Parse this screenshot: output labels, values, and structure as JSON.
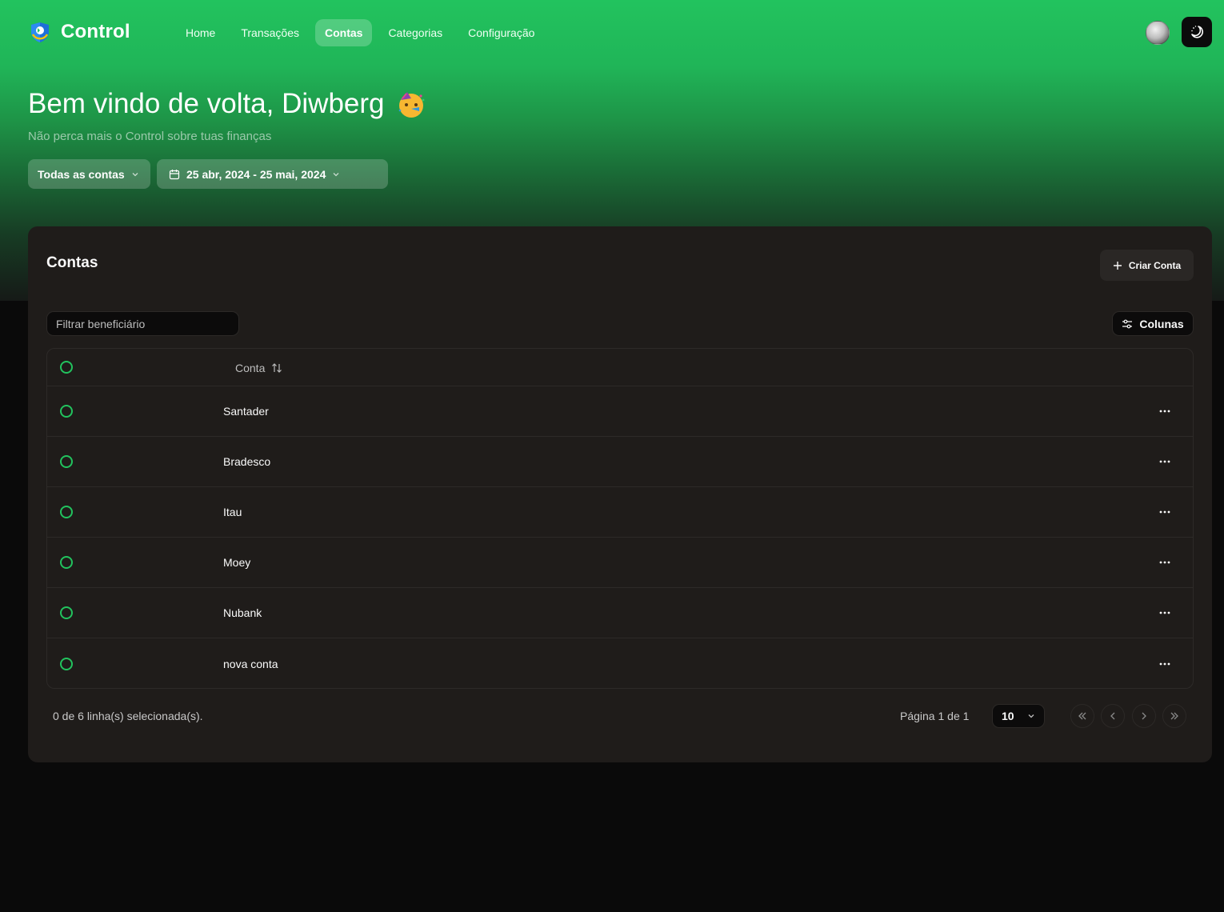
{
  "colors": {
    "accent": "#22c35e",
    "card_bg": "#1f1c1a",
    "page_bg": "#0a0a0a"
  },
  "nav": {
    "brand": "Control",
    "links": [
      {
        "label": "Home",
        "active": false
      },
      {
        "label": "Transações",
        "active": false
      },
      {
        "label": "Contas",
        "active": true
      },
      {
        "label": "Categorias",
        "active": false
      },
      {
        "label": "Configuração",
        "active": false
      }
    ],
    "avatar_icon": "user-avatar",
    "theme_icon": "moon-icon"
  },
  "hero": {
    "title": "Bem vindo de volta, Diwberg",
    "emoji_icon": "party-face-emoji",
    "subtitle": "Não perca mais o Control sobre tuas finanças",
    "account_filter": "Todas as contas",
    "date_range": "25 abr, 2024 - 25 mai, 2024"
  },
  "card": {
    "title": "Contas",
    "create_label": "Criar Conta",
    "search_placeholder": "Filtrar beneficiário",
    "columns_label": "Colunas",
    "table": {
      "column_header": "Conta",
      "rows": [
        "Santader",
        "Bradesco",
        "Itau",
        "Moey",
        "Nubank",
        "nova conta"
      ]
    },
    "footer": {
      "selected": "0 de 6 linha(s) selecionada(s).",
      "page_info": "Página 1 de 1",
      "page_size": "10"
    }
  }
}
